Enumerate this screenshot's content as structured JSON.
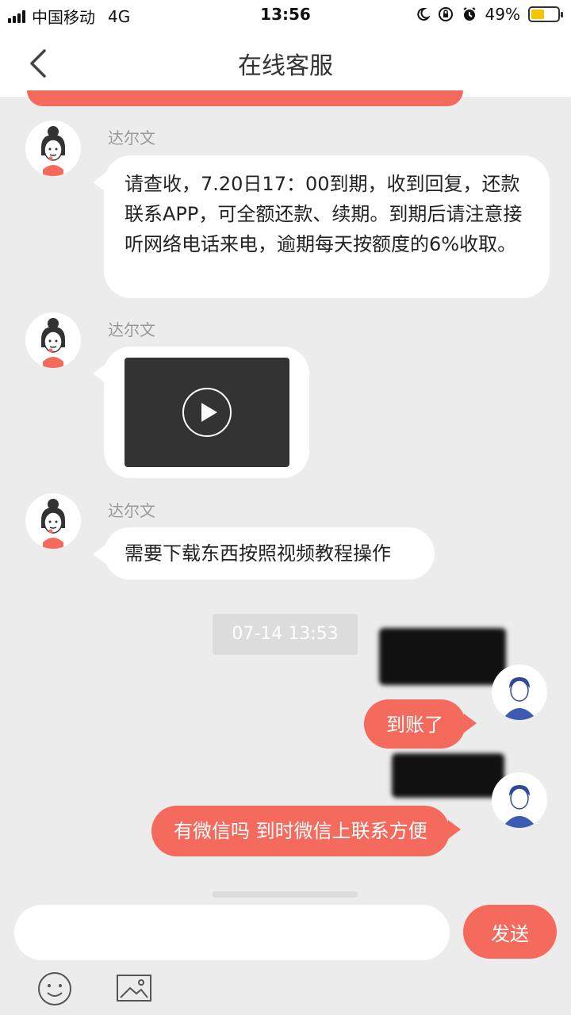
{
  "status_bar": {
    "carrier": "中国移动",
    "network": "4G",
    "time": "13:56",
    "battery": "49%",
    "battery_level": 0.49
  },
  "header": {
    "title": "在线客服"
  },
  "messages": [
    {
      "sender": "达尔文",
      "text": "请查收，7.20日17：00到期，收到回复，还款联系APP，可全额还款、续期。到期后请注意接听网络电话来电，逾期每天按额度的6%收取。"
    },
    {
      "sender": "达尔文",
      "type": "video"
    },
    {
      "sender": "达尔文",
      "text": "需要下载东西按照视频教程操作"
    }
  ],
  "timestamp": "07-14 13:53",
  "user_messages": [
    {
      "text": "到账了"
    },
    {
      "text": "有微信吗 到时微信上联系方便"
    }
  ],
  "composer": {
    "placeholder": "",
    "send_label": "发送"
  },
  "colors": {
    "accent": "#f46b5e",
    "background": "#ececec"
  },
  "icons": [
    "back-icon",
    "agent-avatar-icon",
    "user-avatar-icon",
    "play-icon",
    "emoji-icon",
    "image-icon"
  ]
}
